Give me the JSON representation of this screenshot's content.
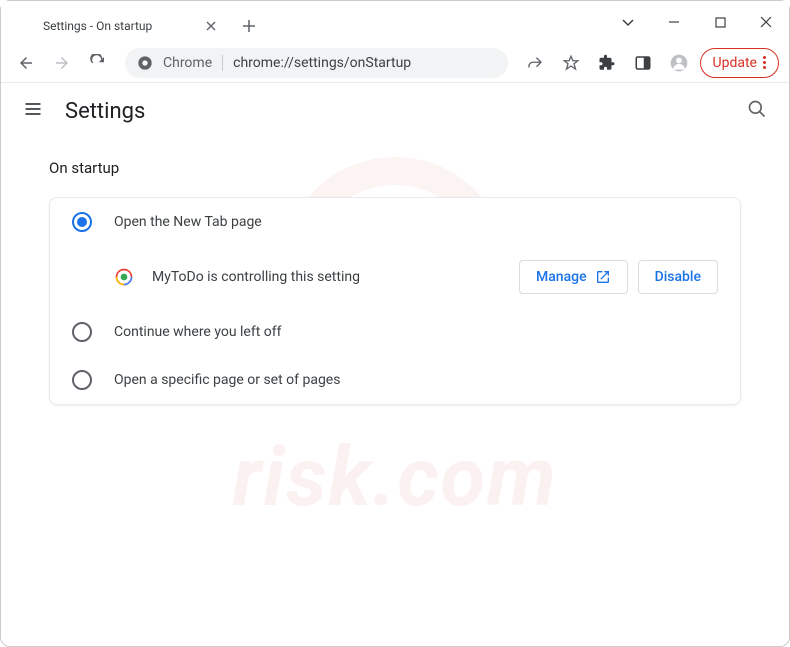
{
  "tab": {
    "title": "Settings - On startup"
  },
  "omnibox": {
    "prefix": "Chrome",
    "url": "chrome://settings/onStartup"
  },
  "update": {
    "label": "Update"
  },
  "settings": {
    "title": "Settings"
  },
  "section": {
    "title": "On startup"
  },
  "options": {
    "new_tab": "Open the New Tab page",
    "continue": "Continue where you left off",
    "specific": "Open a specific page or set of pages"
  },
  "extension": {
    "name": "MyToDo",
    "message": "MyToDo is controlling this setting",
    "manage": "Manage",
    "disable": "Disable"
  },
  "colors": {
    "accent": "#1a73e8",
    "danger": "#d93025"
  },
  "watermark": "risk.com"
}
